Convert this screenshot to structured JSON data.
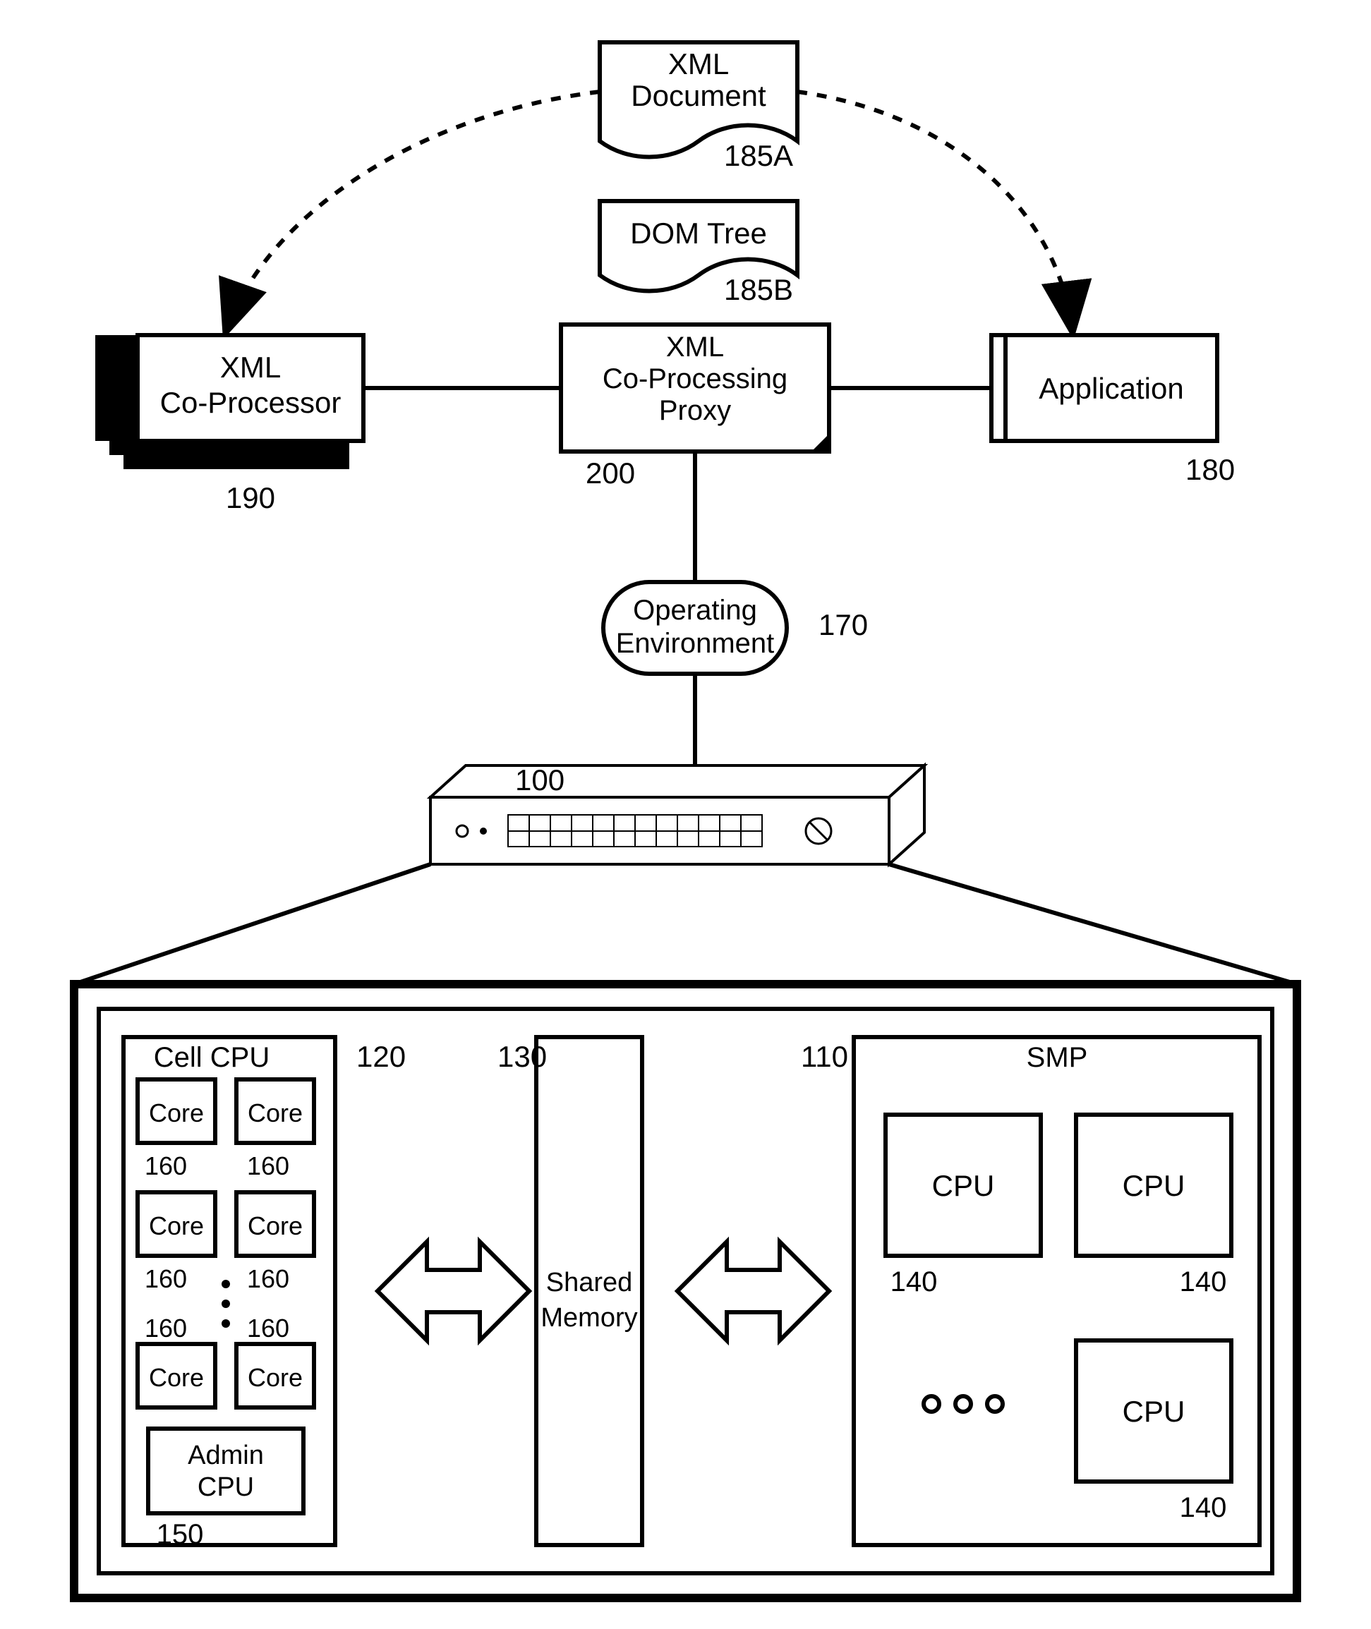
{
  "doc": {
    "title1": "XML",
    "title2": "Document",
    "ref": "185A"
  },
  "dom": {
    "title": "DOM Tree",
    "ref": "185B"
  },
  "coproc": {
    "line1": "XML",
    "line2": "Co-Processor",
    "ref": "190"
  },
  "proxy": {
    "line1": "XML",
    "line2": "Co-Processing",
    "line3": "Proxy",
    "ref": "200"
  },
  "app": {
    "title": "Application",
    "ref": "180"
  },
  "opEnv": {
    "line1": "Operating",
    "line2": "Environment",
    "ref": "170"
  },
  "device": {
    "ref": "100"
  },
  "cellCpu": {
    "title": "Cell CPU",
    "ref": "120",
    "core": "Core",
    "coreRef": "160",
    "admin1": "Admin",
    "admin2": "CPU",
    "adminRef": "150"
  },
  "sharedMem": {
    "line1": "Shared",
    "line2": "Memory",
    "ref": "130"
  },
  "smp": {
    "title": "SMP",
    "ref": "110",
    "cpu": "CPU",
    "cpuRef": "140"
  },
  "ellipsis3": "○ ○ ○"
}
